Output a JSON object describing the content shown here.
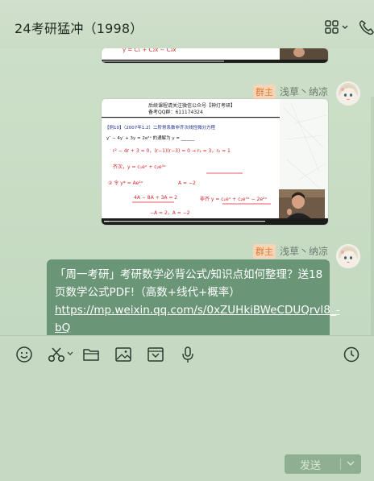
{
  "header": {
    "title": "24考研猛冲（1998）",
    "more_icon": "apps-grid-icon",
    "call_icon": "phone-icon"
  },
  "messages": [
    {
      "type": "video-thumbnail",
      "formula_line": "y = C₁ + C₂x − C₃x",
      "partial": true
    },
    {
      "type": "video-thumbnail",
      "sender_badge": "群主",
      "sender_name": "浅草丶纳凉",
      "thumb_header_line1": "后续课程请关注微信公众号【神灯考研】",
      "thumb_header_line2": "备考QQ群：611174324",
      "thumb_problem": "【例10】（2007年1.2）二阶常系数非齐次线性微分方程",
      "thumb_eq": "y″ − 4y′ + 3y = 2e²ˣ 的通解为 y = ______",
      "thumb_step1": "r² − 4r + 3 = 0，(r−1)(r−3) = 0 → r₁ = 3，r₂ = 1",
      "thumb_step2": "齐次，y = c₁eˣ + c₂e³ˣ",
      "thumb_step3": "② 令 y* = Ae²ˣ",
      "thumb_step4": "4A − 8A + 3A = 2",
      "thumb_step5": "A = −2",
      "thumb_answer": "非齐 y = c₁eˣ + c₂e³ˣ − 2e²ˣ",
      "thumb_foot": "−A = 2，A = −2"
    },
    {
      "type": "text",
      "sender_badge": "群主",
      "sender_name": "浅草丶纳凉",
      "text": "「周一考研」考研数学必背公式/知识点如何整理？送18页数学公式PDF!（高数+线代+概率）",
      "link": "https://mp.weixin.qq.com/s/0xZUHkiBWeCDUQrvI8_-bQ"
    }
  ],
  "toolbar": {
    "icons": [
      "emoji-icon",
      "scissors-icon",
      "folder-icon",
      "image-icon",
      "mini-program-icon",
      "microphone-icon",
      "history-icon"
    ]
  },
  "send_button": {
    "label": "发送"
  },
  "colors": {
    "chat_background": "#c5d9c3",
    "bubble": "#6a9677",
    "badge_text": "#e07a2e",
    "badge_bg": "#f5d5b8",
    "send_button": "#8faf92"
  }
}
